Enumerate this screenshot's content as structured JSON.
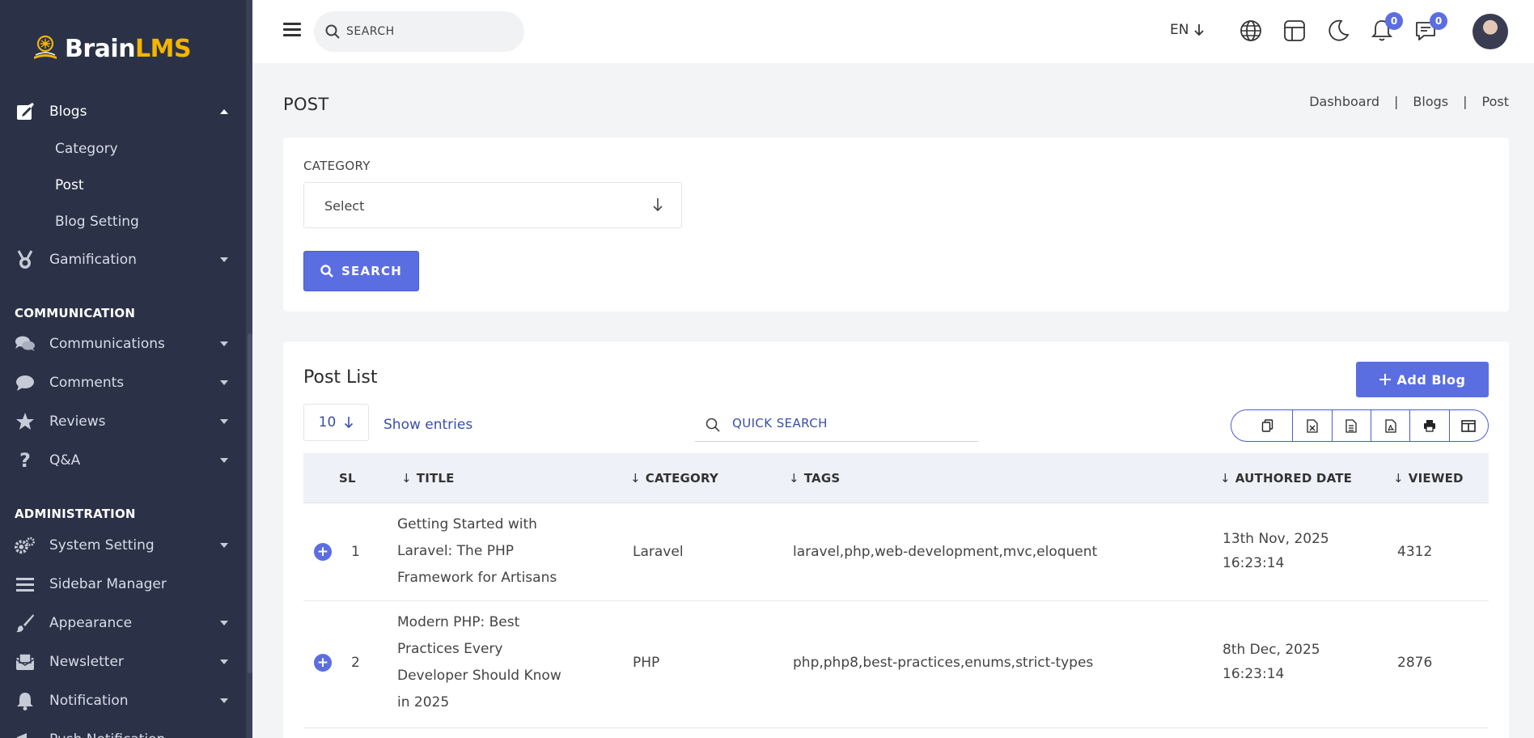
{
  "brand": {
    "name_part1": "Brain",
    "name_part2": "LMS"
  },
  "sidebar": {
    "items": [
      {
        "label": "Blogs",
        "icon": "edit-icon"
      },
      {
        "label": "Gamification",
        "icon": "medal-icon"
      },
      {
        "label": "Communications",
        "icon": "chat-bubbles-icon"
      },
      {
        "label": "Comments",
        "icon": "comment-icon"
      },
      {
        "label": "Reviews",
        "icon": "star-icon"
      },
      {
        "label": "Q&A",
        "icon": "question-icon"
      },
      {
        "label": "System Setting",
        "icon": "gears-icon"
      },
      {
        "label": "Sidebar Manager",
        "icon": "bars-icon"
      },
      {
        "label": "Appearance",
        "icon": "brush-icon"
      },
      {
        "label": "Newsletter",
        "icon": "mail-icon"
      },
      {
        "label": "Notification",
        "icon": "bell-icon"
      },
      {
        "label": "Push Notification",
        "icon": "megaphone-icon"
      }
    ],
    "blog_sub_items": [
      "Category",
      "Post",
      "Blog Setting"
    ],
    "section_communication": "COMMUNICATION",
    "section_administration": "ADMINISTRATION"
  },
  "topbar": {
    "search_placeholder": "SEARCH",
    "language": "EN",
    "notifications_count": "0",
    "messages_count": "0"
  },
  "page": {
    "title": "POST",
    "breadcrumb": [
      "Dashboard",
      "Blogs",
      "Post"
    ],
    "breadcrumb_sep": "|"
  },
  "filter": {
    "category_label": "CATEGORY",
    "category_value": "Select",
    "search_button": "SEARCH"
  },
  "post_list": {
    "title": "Post List",
    "add_button": "Add Blog",
    "entries_value": "10",
    "entries_label": "Show entries",
    "quick_search_placeholder": "QUICK SEARCH",
    "columns": {
      "sl": "SL",
      "title": "TITLE",
      "category": "CATEGORY",
      "tags": "TAGS",
      "authored_date": "AUTHORED DATE",
      "viewed": "VIEWED"
    },
    "rows": [
      {
        "sl": "1",
        "title_lines": [
          "Getting Started with",
          "Laravel: The PHP",
          "Framework for Artisans"
        ],
        "category": "Laravel",
        "tags": "laravel,php,web-development,mvc,eloquent",
        "date": "13th Nov, 2025",
        "time": "16:23:14",
        "viewed": "4312"
      },
      {
        "sl": "2",
        "title_lines": [
          "Modern PHP: Best",
          "Practices Every",
          "Developer Should Know",
          "in 2025"
        ],
        "category": "PHP",
        "tags": "php,php8,best-practices,enums,strict-types",
        "date": "8th Dec, 2025",
        "time": "16:23:14",
        "viewed": "2876"
      }
    ]
  },
  "colors": {
    "sidebar_bg": "#2b3247",
    "accent": "#5b6ee1",
    "logo_accent": "#f4b400"
  }
}
